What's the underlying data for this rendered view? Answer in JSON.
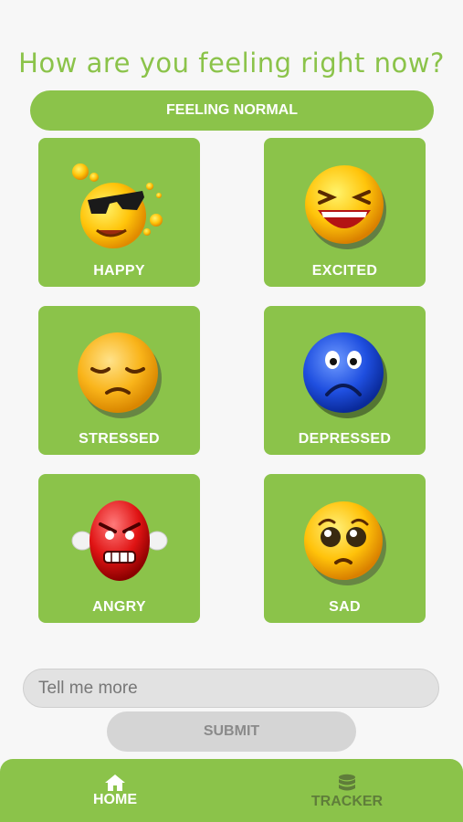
{
  "header": {
    "question": "How are you feeling right now?"
  },
  "status": {
    "text": "FEELING NORMAL"
  },
  "moods": [
    {
      "label": "HAPPY",
      "icon": "cool-sunglasses-emoji-icon"
    },
    {
      "label": "EXCITED",
      "icon": "laughing-emoji-icon"
    },
    {
      "label": "STRESSED",
      "icon": "disappointed-emoji-icon"
    },
    {
      "label": "DEPRESSED",
      "icon": "worried-blue-emoji-icon"
    },
    {
      "label": "ANGRY",
      "icon": "angry-red-emoji-icon"
    },
    {
      "label": "SAD",
      "icon": "pleading-emoji-icon"
    }
  ],
  "form": {
    "placeholder": "Tell me more",
    "value": "",
    "submit_label": "SUBMIT"
  },
  "nav": {
    "home_label": "HOME",
    "tracker_label": "TRACKER",
    "active": "home"
  },
  "colors": {
    "accent": "#8bc34a",
    "active_nav": "#ffffff",
    "inactive_nav": "#5f7d3a"
  }
}
